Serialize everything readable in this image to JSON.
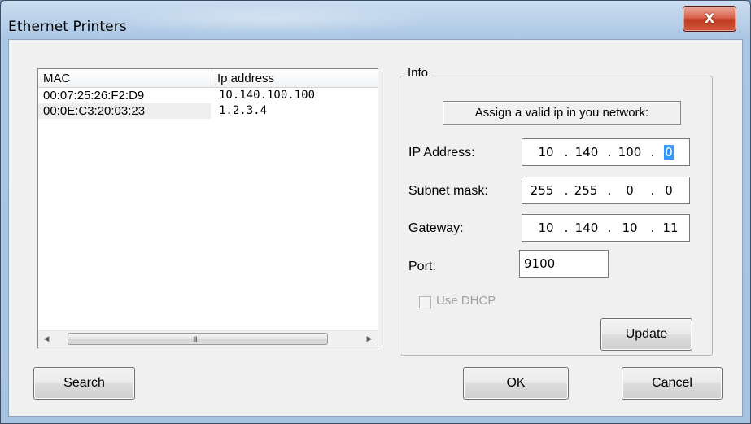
{
  "window": {
    "title": "Ethernet Printers",
    "close_glyph": "X"
  },
  "list": {
    "columns": [
      "MAC",
      "Ip address"
    ],
    "rows": [
      {
        "mac": "00:07:25:26:F2:D9",
        "ip": "10.140.100.100"
      },
      {
        "mac": "00:0E:C3:20:03:23",
        "ip": "1.2.3.4"
      }
    ],
    "scroll": {
      "left_arrow": "◀",
      "right_arrow": "▶",
      "grip": "III"
    }
  },
  "buttons": {
    "search": "Search",
    "ok": "OK",
    "cancel": "Cancel",
    "update": "Update"
  },
  "info": {
    "caption": "Info",
    "hint": "Assign a valid ip in you network:",
    "ip_address": {
      "label": "IP Address:",
      "octets": [
        "10",
        "140",
        "100",
        "0"
      ]
    },
    "subnet_mask": {
      "label": "Subnet mask:",
      "octets": [
        "255",
        "255",
        "0",
        "0"
      ]
    },
    "gateway": {
      "label": "Gateway:",
      "octets": [
        "10",
        "140",
        "10",
        "11"
      ]
    },
    "port": {
      "label": "Port:",
      "value": "9100"
    },
    "dhcp": {
      "label": "Use DHCP",
      "checked": false,
      "enabled": false
    }
  }
}
